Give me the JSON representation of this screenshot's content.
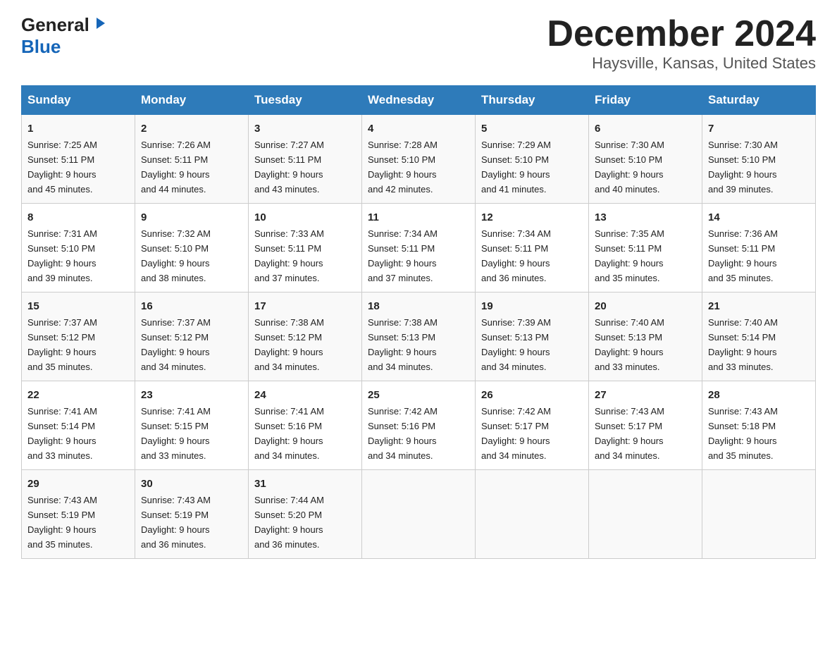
{
  "header": {
    "logo_general": "General",
    "logo_blue": "Blue",
    "title": "December 2024",
    "subtitle": "Haysville, Kansas, United States"
  },
  "columns": [
    "Sunday",
    "Monday",
    "Tuesday",
    "Wednesday",
    "Thursday",
    "Friday",
    "Saturday"
  ],
  "weeks": [
    [
      {
        "day": "1",
        "sunrise": "7:25 AM",
        "sunset": "5:11 PM",
        "daylight": "9 hours and 45 minutes."
      },
      {
        "day": "2",
        "sunrise": "7:26 AM",
        "sunset": "5:11 PM",
        "daylight": "9 hours and 44 minutes."
      },
      {
        "day": "3",
        "sunrise": "7:27 AM",
        "sunset": "5:11 PM",
        "daylight": "9 hours and 43 minutes."
      },
      {
        "day": "4",
        "sunrise": "7:28 AM",
        "sunset": "5:10 PM",
        "daylight": "9 hours and 42 minutes."
      },
      {
        "day": "5",
        "sunrise": "7:29 AM",
        "sunset": "5:10 PM",
        "daylight": "9 hours and 41 minutes."
      },
      {
        "day": "6",
        "sunrise": "7:30 AM",
        "sunset": "5:10 PM",
        "daylight": "9 hours and 40 minutes."
      },
      {
        "day": "7",
        "sunrise": "7:30 AM",
        "sunset": "5:10 PM",
        "daylight": "9 hours and 39 minutes."
      }
    ],
    [
      {
        "day": "8",
        "sunrise": "7:31 AM",
        "sunset": "5:10 PM",
        "daylight": "9 hours and 39 minutes."
      },
      {
        "day": "9",
        "sunrise": "7:32 AM",
        "sunset": "5:10 PM",
        "daylight": "9 hours and 38 minutes."
      },
      {
        "day": "10",
        "sunrise": "7:33 AM",
        "sunset": "5:11 PM",
        "daylight": "9 hours and 37 minutes."
      },
      {
        "day": "11",
        "sunrise": "7:34 AM",
        "sunset": "5:11 PM",
        "daylight": "9 hours and 37 minutes."
      },
      {
        "day": "12",
        "sunrise": "7:34 AM",
        "sunset": "5:11 PM",
        "daylight": "9 hours and 36 minutes."
      },
      {
        "day": "13",
        "sunrise": "7:35 AM",
        "sunset": "5:11 PM",
        "daylight": "9 hours and 35 minutes."
      },
      {
        "day": "14",
        "sunrise": "7:36 AM",
        "sunset": "5:11 PM",
        "daylight": "9 hours and 35 minutes."
      }
    ],
    [
      {
        "day": "15",
        "sunrise": "7:37 AM",
        "sunset": "5:12 PM",
        "daylight": "9 hours and 35 minutes."
      },
      {
        "day": "16",
        "sunrise": "7:37 AM",
        "sunset": "5:12 PM",
        "daylight": "9 hours and 34 minutes."
      },
      {
        "day": "17",
        "sunrise": "7:38 AM",
        "sunset": "5:12 PM",
        "daylight": "9 hours and 34 minutes."
      },
      {
        "day": "18",
        "sunrise": "7:38 AM",
        "sunset": "5:13 PM",
        "daylight": "9 hours and 34 minutes."
      },
      {
        "day": "19",
        "sunrise": "7:39 AM",
        "sunset": "5:13 PM",
        "daylight": "9 hours and 34 minutes."
      },
      {
        "day": "20",
        "sunrise": "7:40 AM",
        "sunset": "5:13 PM",
        "daylight": "9 hours and 33 minutes."
      },
      {
        "day": "21",
        "sunrise": "7:40 AM",
        "sunset": "5:14 PM",
        "daylight": "9 hours and 33 minutes."
      }
    ],
    [
      {
        "day": "22",
        "sunrise": "7:41 AM",
        "sunset": "5:14 PM",
        "daylight": "9 hours and 33 minutes."
      },
      {
        "day": "23",
        "sunrise": "7:41 AM",
        "sunset": "5:15 PM",
        "daylight": "9 hours and 33 minutes."
      },
      {
        "day": "24",
        "sunrise": "7:41 AM",
        "sunset": "5:16 PM",
        "daylight": "9 hours and 34 minutes."
      },
      {
        "day": "25",
        "sunrise": "7:42 AM",
        "sunset": "5:16 PM",
        "daylight": "9 hours and 34 minutes."
      },
      {
        "day": "26",
        "sunrise": "7:42 AM",
        "sunset": "5:17 PM",
        "daylight": "9 hours and 34 minutes."
      },
      {
        "day": "27",
        "sunrise": "7:43 AM",
        "sunset": "5:17 PM",
        "daylight": "9 hours and 34 minutes."
      },
      {
        "day": "28",
        "sunrise": "7:43 AM",
        "sunset": "5:18 PM",
        "daylight": "9 hours and 35 minutes."
      }
    ],
    [
      {
        "day": "29",
        "sunrise": "7:43 AM",
        "sunset": "5:19 PM",
        "daylight": "9 hours and 35 minutes."
      },
      {
        "day": "30",
        "sunrise": "7:43 AM",
        "sunset": "5:19 PM",
        "daylight": "9 hours and 36 minutes."
      },
      {
        "day": "31",
        "sunrise": "7:44 AM",
        "sunset": "5:20 PM",
        "daylight": "9 hours and 36 minutes."
      },
      null,
      null,
      null,
      null
    ]
  ],
  "labels": {
    "sunrise": "Sunrise:",
    "sunset": "Sunset:",
    "daylight": "Daylight:"
  }
}
